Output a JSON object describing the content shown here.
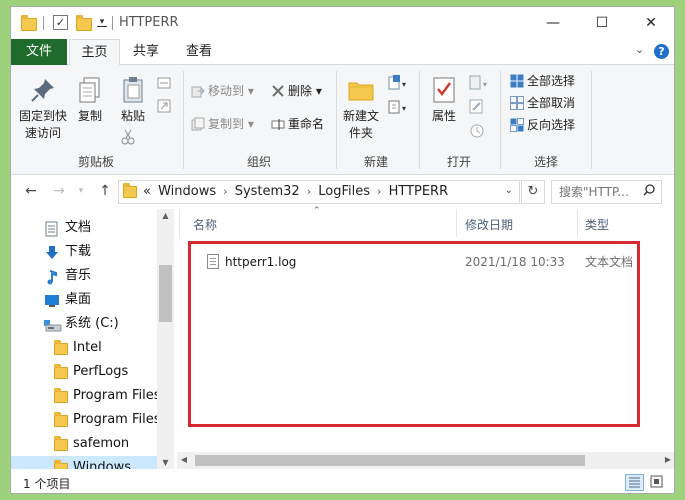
{
  "window": {
    "title": "HTTPERR",
    "minimize": "—",
    "maximize": "☐",
    "close": "✕"
  },
  "ribbon_tabs": {
    "file": "文件",
    "home": "主页",
    "share": "共享",
    "view": "查看"
  },
  "ribbon": {
    "clipboard": {
      "label": "剪贴板",
      "pin": "固定到快速访问",
      "copy": "复制",
      "paste": "粘贴"
    },
    "organize": {
      "label": "组织",
      "move_to": "移动到",
      "copy_to": "复制到",
      "delete": "删除",
      "rename": "重命名"
    },
    "new": {
      "label": "新建",
      "new_folder": "新建文件夹"
    },
    "open": {
      "label": "打开",
      "properties": "属性"
    },
    "select": {
      "label": "选择",
      "select_all": "全部选择",
      "select_none": "全部取消",
      "invert": "反向选择"
    }
  },
  "address": {
    "overflow": "«",
    "crumbs": [
      "Windows",
      "System32",
      "LogFiles",
      "HTTPERR"
    ],
    "search_placeholder": "搜索\"HTTP..."
  },
  "nav": {
    "items": [
      {
        "label": "文档",
        "icon": "document-icon"
      },
      {
        "label": "下载",
        "icon": "download-icon"
      },
      {
        "label": "音乐",
        "icon": "music-icon"
      },
      {
        "label": "桌面",
        "icon": "desktop-icon"
      },
      {
        "label": "系统 (C:)",
        "icon": "drive-icon"
      },
      {
        "label": "Intel",
        "icon": "folder-icon"
      },
      {
        "label": "PerfLogs",
        "icon": "folder-icon"
      },
      {
        "label": "Program Files",
        "icon": "folder-icon"
      },
      {
        "label": "Program Files",
        "icon": "folder-icon"
      },
      {
        "label": "safemon",
        "icon": "folder-icon"
      },
      {
        "label": "Windows",
        "icon": "folder-icon"
      }
    ]
  },
  "columns": {
    "name": "名称",
    "modified": "修改日期",
    "type": "类型"
  },
  "files": [
    {
      "name": "httperr1.log",
      "modified": "2021/1/18 10:33",
      "type": "文本文档"
    }
  ],
  "status": {
    "item_count": "1 个项目"
  },
  "colors": {
    "file_tab": "#1f6b2c",
    "highlight_box": "#d52a30",
    "selection": "#cce8ff",
    "desktop_bg": "#9fd27c"
  }
}
